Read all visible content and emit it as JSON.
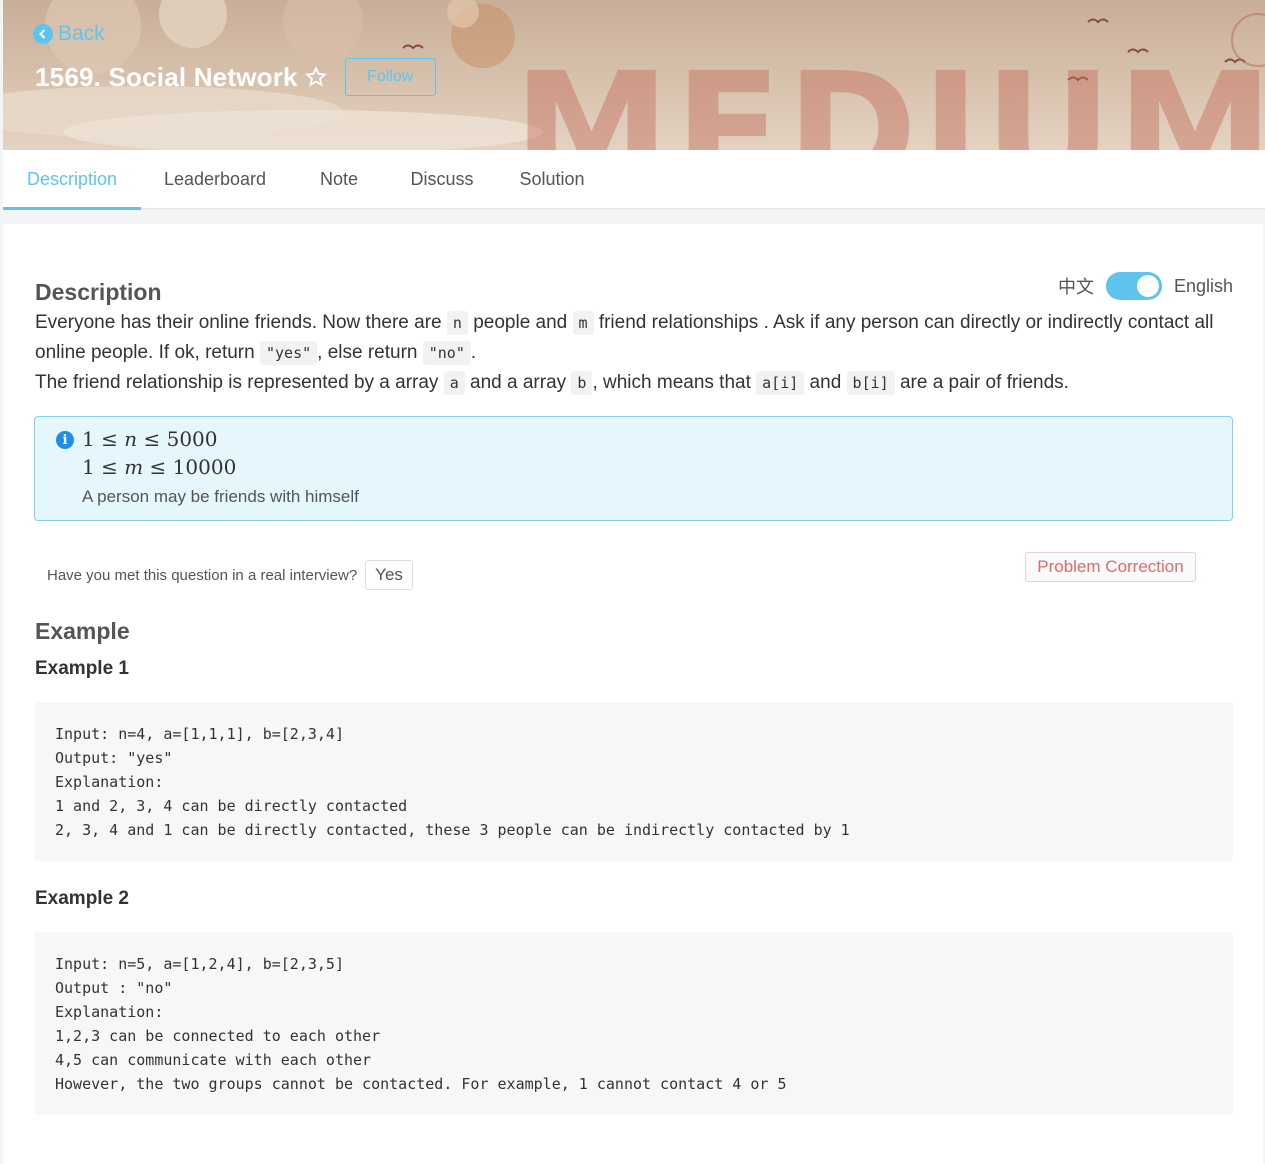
{
  "header": {
    "back_label": "Back",
    "problem_title": "1569. Social Network",
    "follow_label": "Follow",
    "difficulty_watermark": "MEDIUM"
  },
  "tabs": [
    {
      "label": "Description",
      "active": true
    },
    {
      "label": "Leaderboard",
      "active": false
    },
    {
      "label": "Note",
      "active": false
    },
    {
      "label": "Discuss",
      "active": false
    },
    {
      "label": "Solution",
      "active": false
    }
  ],
  "description": {
    "heading": "Description",
    "lang_cn": "中文",
    "lang_en": "English",
    "p1_a": "Everyone has their online friends. Now there are ",
    "code_n": "n",
    "p1_b": " people and ",
    "code_m": "m",
    "p1_c": " friend relationships . Ask if any person can directly or indirectly contact all online people. If ok, return ",
    "code_yes": "\"yes\"",
    "p1_d": ", else return ",
    "code_no": "\"no\"",
    "p1_e": ".",
    "p2_a": "The friend relationship is represented by a array ",
    "code_a": "a",
    "p2_b": " and a array ",
    "code_b": "b",
    "p2_c": ", which means that ",
    "code_ai": "a[i]",
    "p2_d": " and ",
    "code_bi": "b[i]",
    "p2_e": " are a pair of friends."
  },
  "constraints": {
    "line1_lo": "1",
    "line1_op1": "≤",
    "line1_var": "n",
    "line1_op2": "≤",
    "line1_hi": "5000",
    "line2_lo": "1",
    "line2_op1": "≤",
    "line2_var": "m",
    "line2_op2": "≤",
    "line2_hi": "10000",
    "note": "A person may be friends with himself"
  },
  "interview": {
    "question": "Have you met this question in a real interview?",
    "yes_label": "Yes",
    "correction_label": "Problem Correction"
  },
  "examples": {
    "heading": "Example",
    "ex1_label": "Example 1",
    "ex1_code": "Input: n=4, a=[1,1,1], b=[2,3,4]\nOutput: \"yes\"\nExplanation:\n1 and 2, 3, 4 can be directly contacted\n2, 3, 4 and 1 can be directly contacted, these 3 people can be indirectly contacted by 1",
    "ex2_label": "Example 2",
    "ex2_code": "Input: n=5, a=[1,2,4], b=[2,3,5]\nOutput : \"no\"\nExplanation:\n1,2,3 can be connected to each other\n4,5 can communicate with each other\nHowever, the two groups cannot be contacted. For example, 1 cannot contact 4 or 5"
  },
  "colors": {
    "accent": "#5ec4ee",
    "correction": "#e26a6a",
    "info_bg": "#e5f6fd"
  }
}
